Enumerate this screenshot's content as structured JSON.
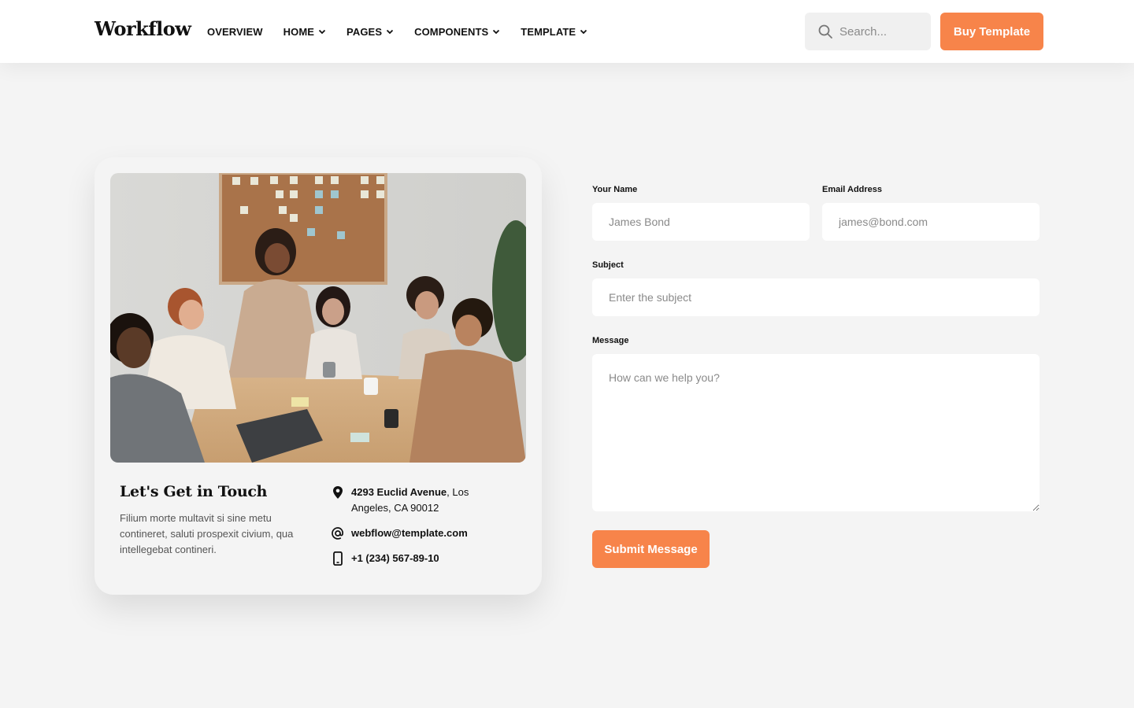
{
  "header": {
    "logo": "Workflow",
    "nav": [
      {
        "label": "OVERVIEW",
        "dropdown": false
      },
      {
        "label": "HOME",
        "dropdown": true
      },
      {
        "label": "PAGES",
        "dropdown": true
      },
      {
        "label": "COMPONENTS",
        "dropdown": true
      },
      {
        "label": "TEMPLATE",
        "dropdown": true
      }
    ],
    "search_placeholder": "Search...",
    "buy_button": "Buy Template"
  },
  "card": {
    "title": "Let's Get in Touch",
    "description": "Filium morte multavit si sine metu contineret, saluti prospexit civium, qua intellegebat contineri.",
    "address_bold": "4293 Euclid Avenue",
    "address_rest": ", Los Angeles, CA 90012",
    "email": "webflow@template.com",
    "phone": "+1 (234) 567-89-10"
  },
  "form": {
    "name_label": "Your Name",
    "name_placeholder": "James Bond",
    "email_label": "Email Address",
    "email_placeholder": "james@bond.com",
    "subject_label": "Subject",
    "subject_placeholder": "Enter the subject",
    "message_label": "Message",
    "message_placeholder": "How can we help you?",
    "submit_label": "Submit Message"
  },
  "colors": {
    "accent": "#f7844a",
    "background": "#f4f4f4"
  }
}
